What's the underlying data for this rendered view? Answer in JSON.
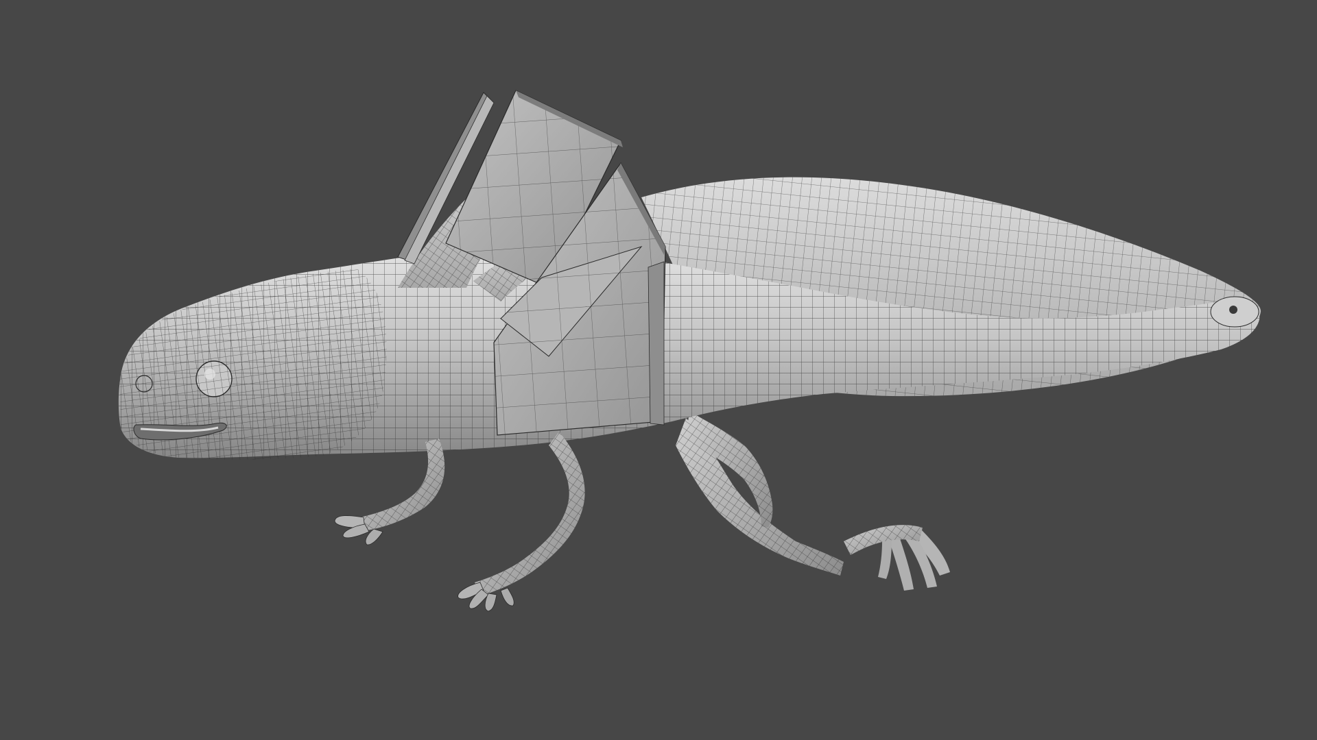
{
  "scene": {
    "subject": "axolotl-3d-wireframe-model",
    "background_color": "#474747",
    "surface_color": "#b9b9b9",
    "highlight_color": "#dedede",
    "shadow_color": "#8a8a8a",
    "wire_color": "#2a2a2a",
    "card_color": "#aaaaaa"
  }
}
